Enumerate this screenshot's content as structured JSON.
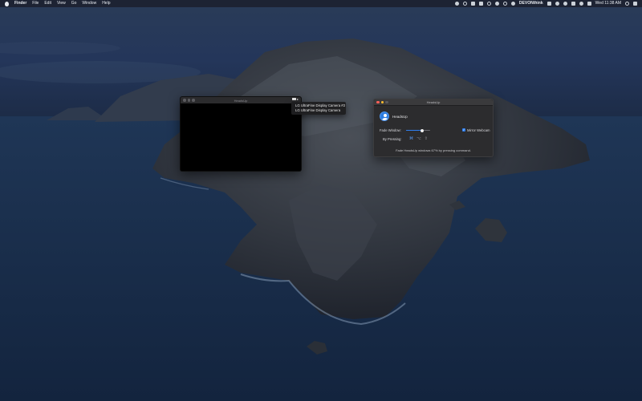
{
  "menubar": {
    "app": "Finder",
    "menus": [
      "File",
      "Edit",
      "View",
      "Go",
      "Window",
      "Help"
    ],
    "status_app": "DEVONthink",
    "clock": "Wed 11:38 AM"
  },
  "camera_window": {
    "title": "HeadsUp"
  },
  "camera_dropdown": {
    "items": [
      "LG UltraFine Display Camera #2",
      "LG UltraFine Display Camera"
    ]
  },
  "settings_window": {
    "title": "HeadsUp",
    "app_name": "HeadsUp",
    "fade_label": "Fade Window:",
    "fade_level": 0.65,
    "mirror_label": "Mirror Webcam",
    "mirror_checked": true,
    "pressing_label": "By Pressing:",
    "keys": [
      {
        "glyph": "⌘",
        "icon": "command-key-icon",
        "active": true
      },
      {
        "glyph": "⌥",
        "icon": "option-key-icon",
        "active": false
      },
      {
        "glyph": "⇧",
        "icon": "shift-key-icon",
        "active": false
      }
    ],
    "hint": "Fade HeadsUp windows 67% by pressing command."
  },
  "colors": {
    "accent": "#2f7ff0",
    "window_bg": "#2c2c2e",
    "close": "#ff5f57",
    "minimize": "#febc2e"
  }
}
